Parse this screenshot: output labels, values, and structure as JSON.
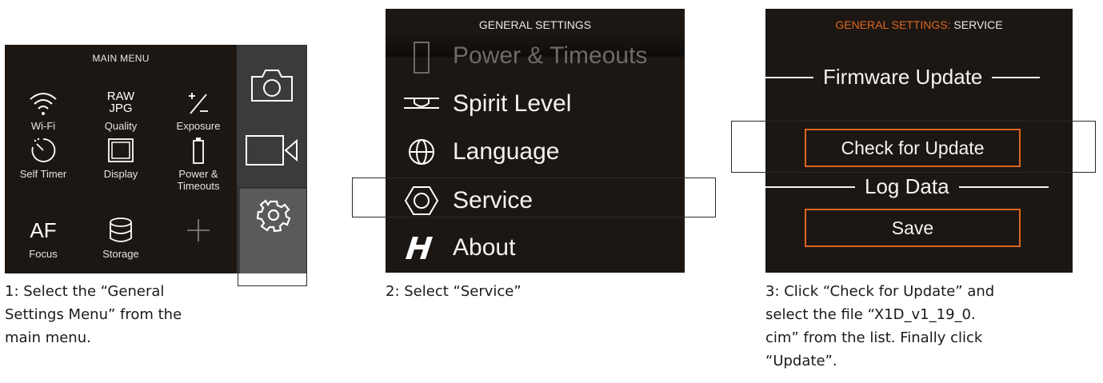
{
  "panel1": {
    "title": "MAIN MENU",
    "items": [
      {
        "label": "Wi-Fi",
        "icon": "wifi-icon"
      },
      {
        "label": "Quality",
        "icon_text_top": "RAW",
        "icon_text_bottom": "JPG"
      },
      {
        "label": "Exposure",
        "icon": "exposure-compensation-icon"
      },
      {
        "label": "Self Timer",
        "icon": "self-timer-icon"
      },
      {
        "label": "Display",
        "icon": "display-icon"
      },
      {
        "label": "Power &",
        "label2": "Timeouts",
        "icon": "battery-icon"
      },
      {
        "label": "Focus",
        "icon_text": "AF"
      },
      {
        "label": "Storage",
        "icon": "storage-icon"
      },
      {
        "label": "",
        "icon": "plus-icon"
      }
    ],
    "side_icons": [
      "camera-icon",
      "video-camera-icon",
      "gear-icon"
    ],
    "caption": [
      "1: Select the “General",
      "Settings Menu” from the",
      "main menu."
    ]
  },
  "panel2": {
    "title": "GENERAL SETTINGS",
    "items": [
      {
        "label": "Power & Timeouts",
        "icon": "battery-icon"
      },
      {
        "label": "Spirit Level",
        "icon": "spirit-level-icon"
      },
      {
        "label": "Language",
        "icon": "globe-icon"
      },
      {
        "label": "Service",
        "icon": "hex-nut-icon"
      },
      {
        "label": "About",
        "icon": "hasselblad-h-icon"
      }
    ],
    "caption": "2: Select “Service”"
  },
  "panel3": {
    "title_prefix": "GENERAL SETTINGS: ",
    "title_suffix": "SERVICE",
    "section1": "Firmware Update",
    "button1": "Check for Update",
    "section2": "Log Data",
    "button2": "Save",
    "caption": [
      "3: Click “Check for Update” and",
      "select the file “X1D_v1_19_0.",
      "cim” from the list. Finally click",
      "“Update”."
    ]
  },
  "colors": {
    "screen_bg": "#1c1713",
    "accent": "#e0661e",
    "side_bg": "#3b3b3b",
    "selected_tile": "#5a5a5a"
  }
}
